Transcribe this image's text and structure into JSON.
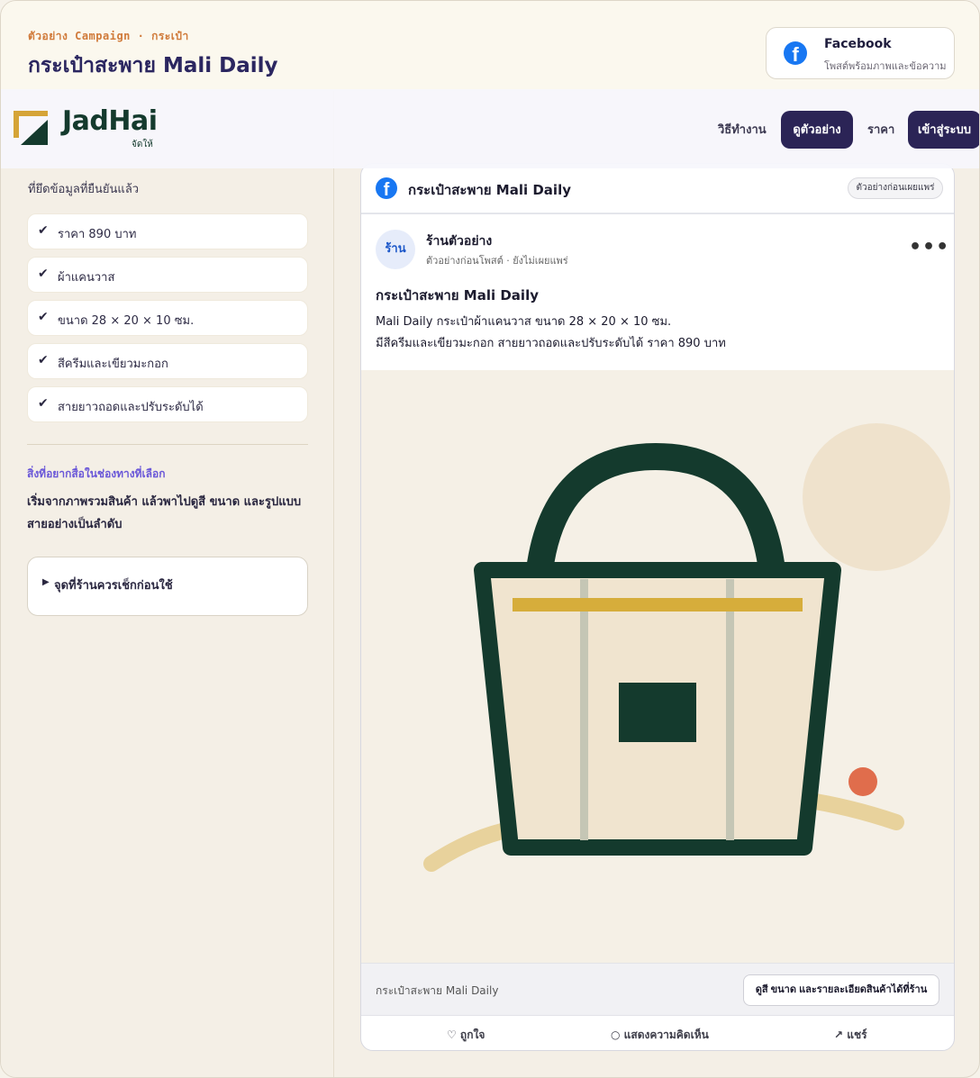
{
  "header": {
    "eyebrow": "ตัวอย่าง Campaign · กระเป๋า",
    "title": "กระเป๋าสะพาย Mali Daily",
    "channel": {
      "icon": "facebook-icon",
      "name": "Facebook",
      "subtitle": "โพสต์พร้อมภาพและข้อความ"
    }
  },
  "nav": {
    "brand": "JadHai",
    "brand_sub": "จัดให้",
    "how_it_works": "วิธีทำงาน",
    "demo": "ดูตัวอย่าง",
    "price": "ราคา",
    "login": "เข้าสู่ระบบ"
  },
  "left": {
    "intro": "ที่ยึดข้อมูลที่ยืนยันแล้ว",
    "facts": [
      "ราคา 890 บาท",
      "ผ้าแคนวาส",
      "ขนาด 28 × 20 × 10 ซม.",
      "สีครีมและเขียวมะกอก",
      "สายยาวถอดและปรับระดับได้"
    ],
    "goal_label": "สิ่งที่อยากสื่อในช่องทางที่เลือก",
    "goal_text": "เริ่มจากภาพรวมสินค้า แล้วพาไปดูสี ขนาด และรูปแบบสายอย่างเป็นลำดับ",
    "checklist_label": "จุดที่ร้านควรเช็กก่อนใช้"
  },
  "preview": {
    "title": "กระเป๋าสะพาย Mali Daily",
    "badge": "ตัวอย่างก่อนเผยแพร่",
    "post": {
      "avatar_text": "ร้าน",
      "shop_name": "ร้านตัวอย่าง",
      "meta": "ตัวอย่างก่อนโพสต์ · ยังไม่เผยแพร่",
      "more": "•••",
      "title": "กระเป๋าสะพาย Mali Daily",
      "body_line1": "Mali Daily กระเป๋าผ้าแคนวาส ขนาด 28 × 20 × 10 ซม.",
      "body_line2": "มีสีครีมและเขียวมะกอก สายยาวถอดและปรับระดับได้ ราคา 890 บาท",
      "link_text": "กระเป๋าสะพาย Mali Daily",
      "link_button": "ดูสี ขนาด และรายละเอียดสินค้าได้ที่ร้าน",
      "actions": {
        "like": "♡ ถูกใจ",
        "comment": "○ แสดงความคิดเห็น",
        "share": "↗ แชร์"
      }
    }
  },
  "colors": {
    "accent": "#2b2456",
    "brand_green": "#143a2d",
    "brand_gold": "#d5a437",
    "facebook": "#1877f2"
  }
}
